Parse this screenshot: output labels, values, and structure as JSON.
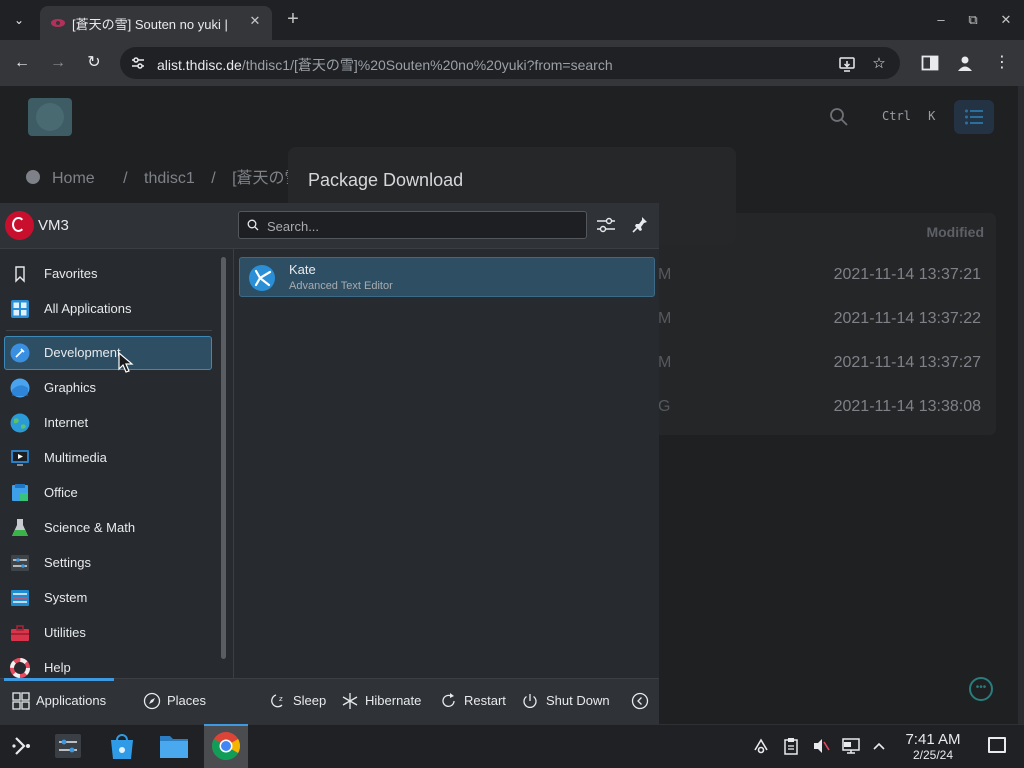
{
  "browser": {
    "tab": {
      "title": "[蒼天の雪] Souten no yuki |",
      "close": "✕"
    },
    "new_tab": "+",
    "url_host": "alist.thdisc.de",
    "url_path": "/thdisc1/[蒼天の雪]%20Souten%20no%20yuki?from=search",
    "window_controls": {
      "minimize": "–",
      "restore": "⧉",
      "close": "✕"
    }
  },
  "page": {
    "search_shortcut": "Ctrl K",
    "breadcrumb": [
      "Home",
      "/",
      "thdisc1",
      "/",
      "[蒼天の雪] So"
    ],
    "dialog_title": "Package Download",
    "file_list": {
      "modified_header": "Modified",
      "rows": [
        {
          "name_tail": "M",
          "modified": "2021-11-14 13:37:21"
        },
        {
          "name_tail": "M",
          "modified": "2021-11-14 13:37:22"
        },
        {
          "name_tail": "M",
          "modified": "2021-11-14 13:37:27"
        },
        {
          "name_tail": "G",
          "modified": "2021-11-14 13:38:08"
        }
      ]
    }
  },
  "launcher": {
    "hostname": "VM3",
    "search_placeholder": "Search...",
    "categories": [
      {
        "label": "Favorites",
        "icon": "bookmark-icon"
      },
      {
        "label": "All Applications",
        "icon": "grid-icon"
      },
      {
        "label": "Development",
        "icon": "development-icon",
        "selected": true
      },
      {
        "label": "Graphics",
        "icon": "graphics-icon"
      },
      {
        "label": "Internet",
        "icon": "globe-icon"
      },
      {
        "label": "Multimedia",
        "icon": "monitor-icon"
      },
      {
        "label": "Office",
        "icon": "office-icon"
      },
      {
        "label": "Science & Math",
        "icon": "flask-icon"
      },
      {
        "label": "Settings",
        "icon": "settings-icon"
      },
      {
        "label": "System",
        "icon": "system-icon"
      },
      {
        "label": "Utilities",
        "icon": "toolbox-icon"
      },
      {
        "label": "Help",
        "icon": "lifebuoy-icon"
      }
    ],
    "apps": [
      {
        "name": "Kate",
        "description": "Advanced Text Editor",
        "icon": "kate-icon"
      }
    ],
    "footer": {
      "applications": "Applications",
      "places": "Places",
      "sleep": "Sleep",
      "hibernate": "Hibernate",
      "restart": "Restart",
      "shut_down": "Shut Down"
    }
  },
  "taskbar": {
    "time": "7:41 AM",
    "date": "2/25/24"
  },
  "colors": {
    "accent": "#3d9ae0",
    "selection": "#2e4f63",
    "debian_red": "#c8102e"
  }
}
